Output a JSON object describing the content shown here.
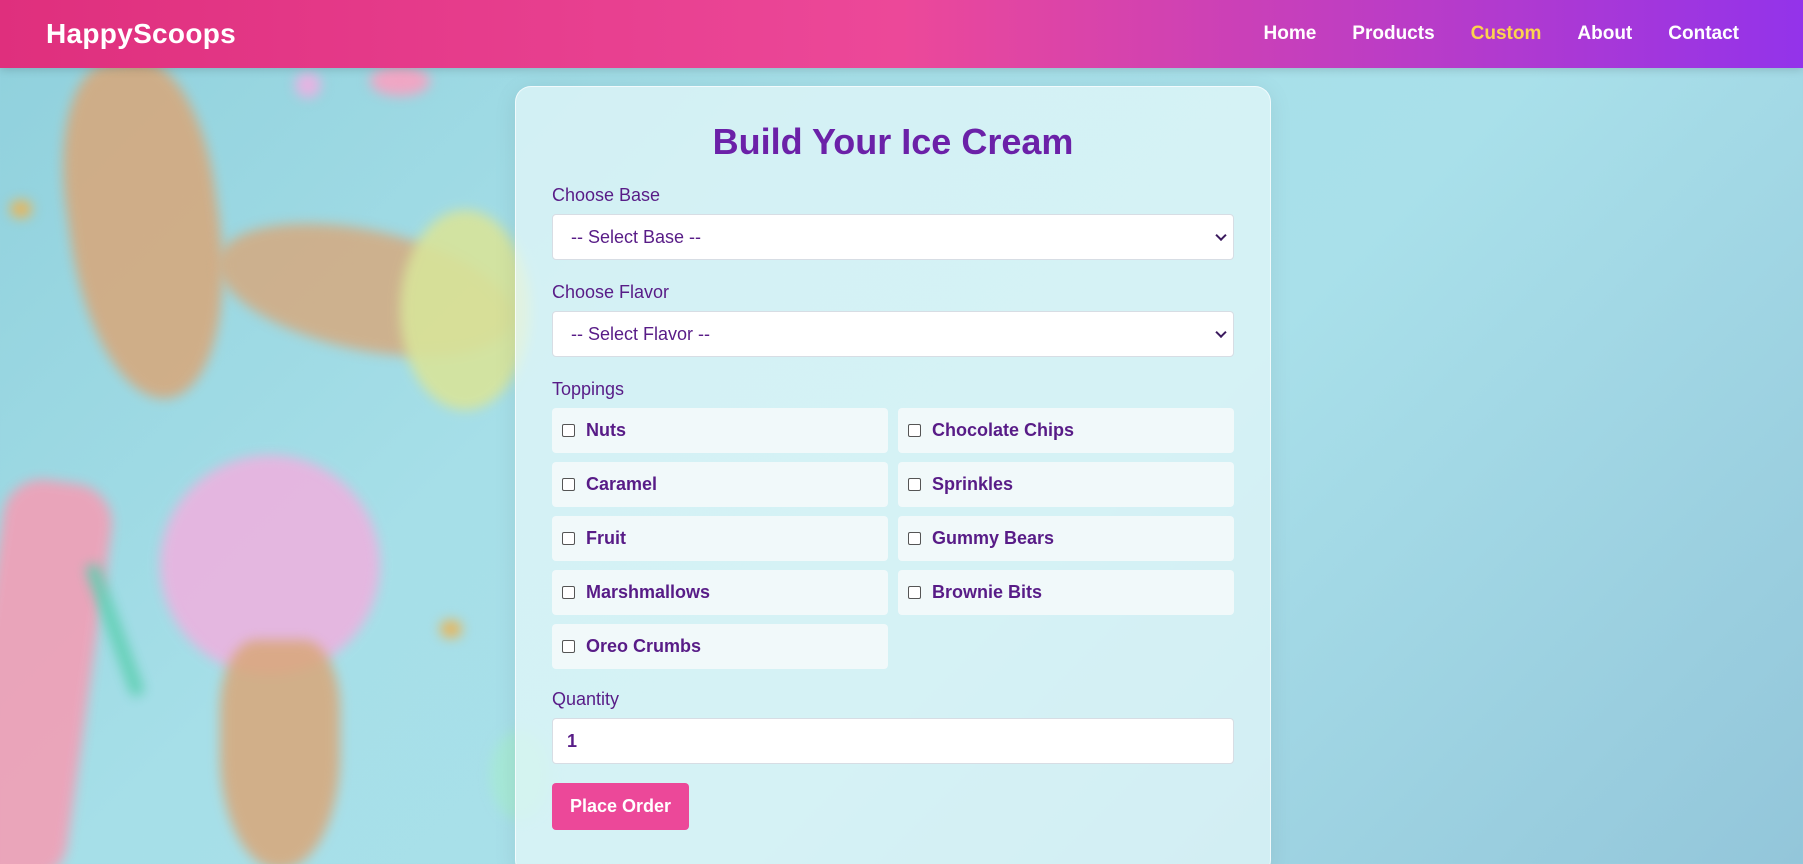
{
  "nav": {
    "brand": "HappyScoops",
    "links": [
      {
        "label": "Home",
        "active": false
      },
      {
        "label": "Products",
        "active": false
      },
      {
        "label": "Custom",
        "active": true
      },
      {
        "label": "About",
        "active": false
      },
      {
        "label": "Contact",
        "active": false
      }
    ]
  },
  "form": {
    "title": "Build Your Ice Cream",
    "base_label": "Choose Base",
    "base_value": "-- Select Base --",
    "flavor_label": "Choose Flavor",
    "flavor_value": "-- Select Flavor --",
    "toppings_label": "Toppings",
    "toppings": [
      "Nuts",
      "Chocolate Chips",
      "Caramel",
      "Sprinkles",
      "Fruit",
      "Gummy Bears",
      "Marshmallows",
      "Brownie Bits",
      "Oreo Crumbs"
    ],
    "quantity_label": "Quantity",
    "quantity_value": "1",
    "submit_label": "Place Order"
  },
  "colors": {
    "nav_start": "#df2f7d",
    "nav_mid": "#ec4899",
    "nav_end": "#9333ea",
    "active_link": "#fcd34d",
    "title": "#6b21a8",
    "text": "#581c87",
    "button": "#ec4899"
  }
}
